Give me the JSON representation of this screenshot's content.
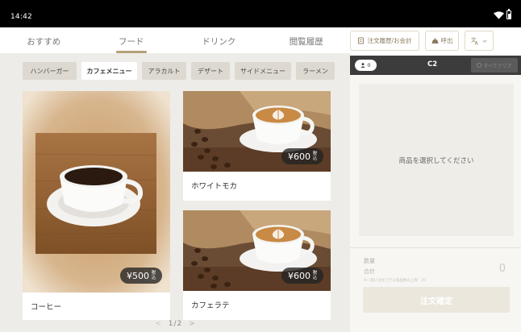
{
  "status_bar": {
    "time": "14:42"
  },
  "nav": {
    "tabs": [
      {
        "label": "おすすめ",
        "active": false
      },
      {
        "label": "フード",
        "active": true
      },
      {
        "label": "ドリンク",
        "active": false
      },
      {
        "label": "閲覧履歴",
        "active": false
      }
    ]
  },
  "toolbar": {
    "history_label": "注文履歴/お会計",
    "call_label": "呼出",
    "language_icon": "translate-icon"
  },
  "categories": [
    {
      "label": "ハンバーガー",
      "active": false
    },
    {
      "label": "カフェメニュー",
      "active": true
    },
    {
      "label": "アラカルト",
      "active": false
    },
    {
      "label": "デザート",
      "active": false
    },
    {
      "label": "サイドメニュー",
      "active": false
    },
    {
      "label": "ラーメン",
      "active": false
    }
  ],
  "products": [
    {
      "name": "コーヒー",
      "price": "¥500",
      "tax": "税込",
      "image": "black-coffee-cup"
    },
    {
      "name": "ホワイトモカ",
      "price": "¥600",
      "tax": "税込",
      "image": "latte-art-cup"
    },
    {
      "name": "カフェラテ",
      "price": "¥600",
      "tax": "税込",
      "image": "latte-art-cup"
    }
  ],
  "pager": {
    "prev": "<",
    "current": "1",
    "separator": "/",
    "total": "2",
    "next": ">"
  },
  "order_panel": {
    "people_count": "0",
    "table_name": "C2",
    "header_button_label": "すべてクリア",
    "empty_message": "商品を選択してください",
    "quantity_label": "数量",
    "total_label": "合計",
    "note": "※一度に注文できる商品数の上限：20",
    "total_value": "0",
    "confirm_label": "注文確定"
  },
  "colors": {
    "accent": "#b5a27a",
    "status_bar": "#000000",
    "panel_header": "#3c3c3c",
    "category_bg": "#eeece8"
  }
}
